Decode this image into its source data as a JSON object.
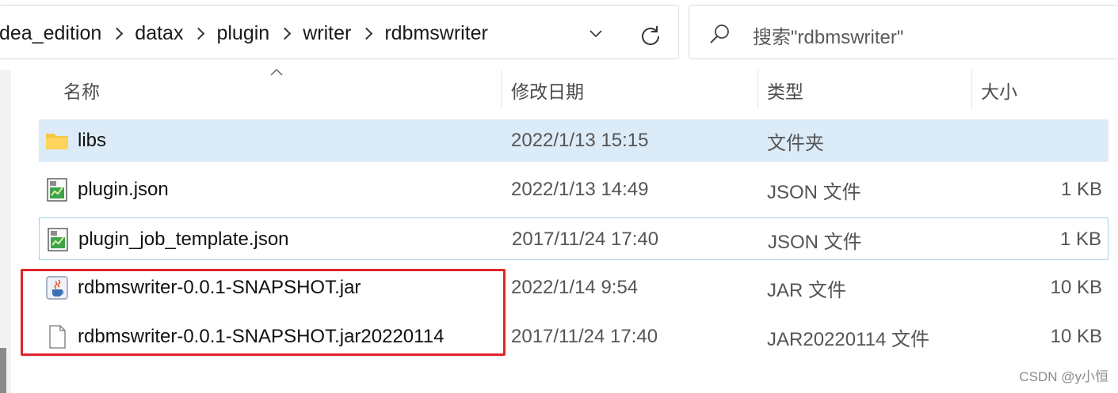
{
  "address_bar": {
    "crumbs": [
      "dea_edition",
      "datax",
      "plugin",
      "writer",
      "rdbmswriter"
    ]
  },
  "search": {
    "placeholder": "搜索\"rdbmswriter\""
  },
  "columns": {
    "name": "名称",
    "date": "修改日期",
    "type": "类型",
    "size": "大小"
  },
  "files": [
    {
      "name": "libs",
      "date": "2022/1/13 15:15",
      "type": "文件夹",
      "size": "",
      "icon": "folder-icon",
      "selected": true
    },
    {
      "name": "plugin.json",
      "date": "2022/1/13 14:49",
      "type": "JSON 文件",
      "size": "1 KB",
      "icon": "json-file-icon"
    },
    {
      "name": "plugin_job_template.json",
      "date": "2017/11/24 17:40",
      "type": "JSON 文件",
      "size": "1 KB",
      "icon": "json-file-icon",
      "focused": true
    },
    {
      "name": "rdbmswriter-0.0.1-SNAPSHOT.jar",
      "date": "2022/1/14 9:54",
      "type": "JAR 文件",
      "size": "10 KB",
      "icon": "jar-file-icon"
    },
    {
      "name": "rdbmswriter-0.0.1-SNAPSHOT.jar20220114",
      "date": "2017/11/24 17:40",
      "type": "JAR20220114 文件",
      "size": "10 KB",
      "icon": "blank-file-icon"
    }
  ],
  "watermark": "CSDN @y小恒",
  "colors": {
    "highlight_box": "#e0232b",
    "selected_row": "#dcebf8",
    "folder": "#f5c542"
  }
}
